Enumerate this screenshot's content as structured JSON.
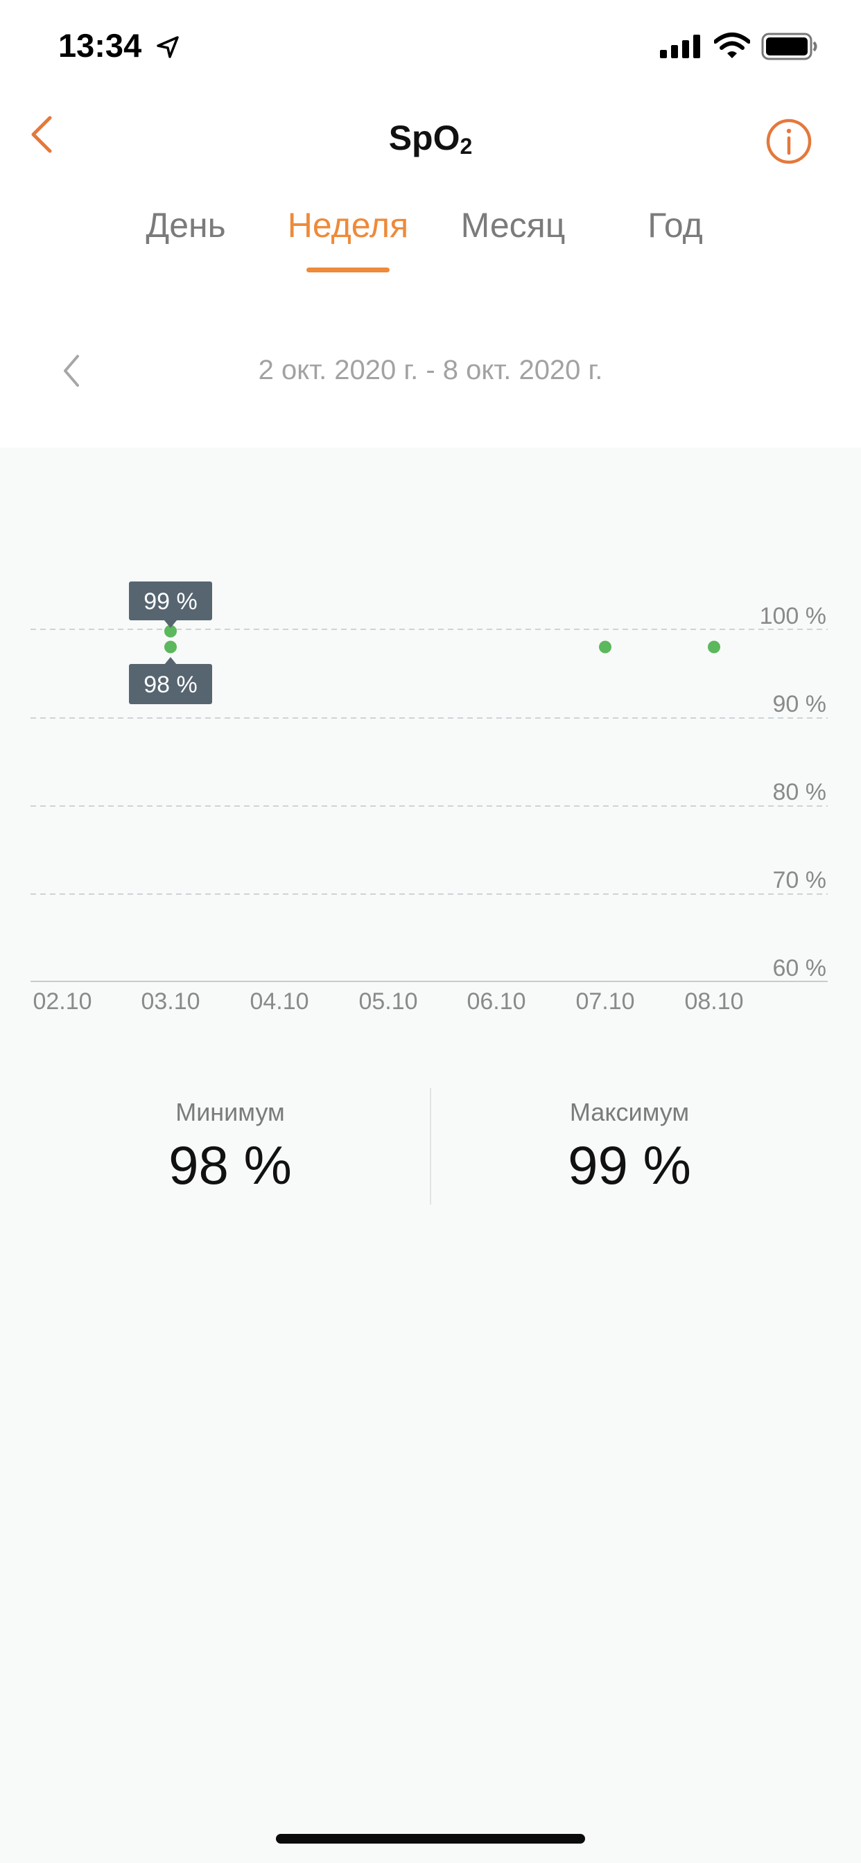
{
  "status_bar": {
    "time": "13:34"
  },
  "nav": {
    "title_main": "SpO",
    "title_sub": "2"
  },
  "tabs": [
    {
      "label": "День"
    },
    {
      "label": "Неделя",
      "active": true
    },
    {
      "label": "Месяц"
    },
    {
      "label": "Год"
    }
  ],
  "date_range": "2 окт. 2020 г. - 8 окт. 2020 г.",
  "chart_data": {
    "type": "scatter",
    "x": [
      "02.10",
      "03.10",
      "04.10",
      "05.10",
      "06.10",
      "07.10",
      "08.10"
    ],
    "y_ticks": [
      "100 %",
      "90 %",
      "80 %",
      "70 %",
      "60 %"
    ],
    "ylim": [
      60,
      100
    ],
    "grid": true,
    "points": [
      {
        "x": "03.10",
        "y": 99
      },
      {
        "x": "03.10",
        "y": 98
      },
      {
        "x": "07.10",
        "y": 98
      },
      {
        "x": "08.10",
        "y": 98
      }
    ],
    "tooltips": [
      "99 %",
      "98 %"
    ],
    "color": "#5bb85c"
  },
  "stats": {
    "min_label": "Минимум",
    "min_value": "98 %",
    "max_label": "Максимум",
    "max_value": "99 %"
  },
  "colors": {
    "accent": "#ee8a3a",
    "tooltip": "#566570"
  }
}
